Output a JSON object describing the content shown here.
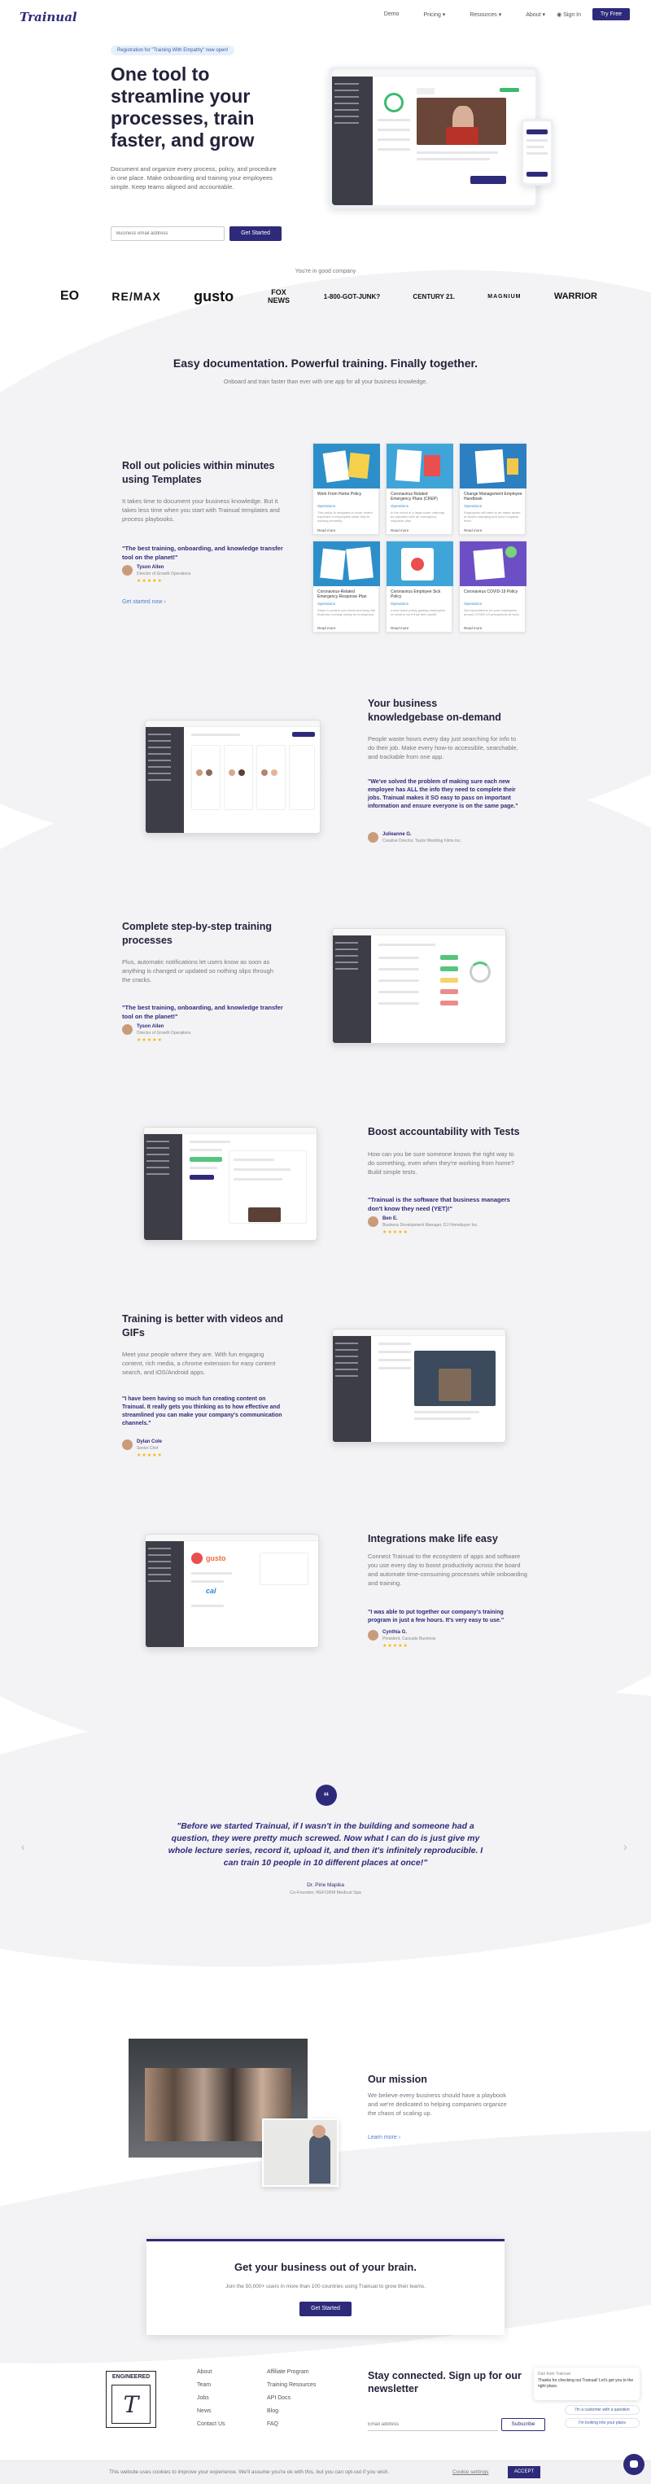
{
  "nav": {
    "logo": "Trainual",
    "links": [
      "Demo",
      "Pricing ▾",
      "Resources ▾",
      "About ▾"
    ],
    "sign_in": "Sign In",
    "try_free": "Try Free"
  },
  "hero": {
    "pill": "Registration for \"Training With Empathy\" now open!",
    "headline": "One tool to streamline your processes, train faster, and grow",
    "lead": "Document and organize every process, policy, and procedure in one place. Make onboarding and training your employees simple. Keep teams aligned and accountable.",
    "email_placeholder": "Business email address",
    "cta": "Get Started"
  },
  "company": {
    "label": "You're in good company",
    "logos": [
      "EO",
      "RE/MAX",
      "gusto",
      "FOX NEWS",
      "1-800-GOT-JUNK?",
      "CENTURY 21.",
      "MAGNIUM",
      "WARRIOR"
    ]
  },
  "intro": {
    "title": "Easy documentation. Powerful training. Finally together.",
    "subtitle": "Onboard and train faster than ever with one app for all your business knowledge."
  },
  "features": [
    {
      "title": "Roll out policies within minutes using Templates",
      "text": "It takes time to document your business knowledge. But it takes less time when you start with Trainual templates and process playbooks.",
      "quote": "\"The best training, onboarding, and knowledge transfer tool on the planet!\"",
      "author": "Tyson Allen",
      "role": "Director of Growth Operations",
      "link": "Get started now ›"
    },
    {
      "title": "Your business knowledgebase on-demand",
      "text": "People waste hours every day just searching for info to do their job. Make every how-to accessible, searchable, and trackable from one app.",
      "quote": "\"We've solved the problem of making sure each new employee has ALL the info they need to complete their jobs. Trainual makes it SO easy to pass on important information and ensure everyone is on the same page.\"",
      "author": "Julieanne G.",
      "role": "Creative Director, Taylor Wedding Films Inc."
    },
    {
      "title": "Complete step-by-step training processes",
      "text": "Plus, automatic notifications let users know as soon as anything is changed or updated so nothing slips through the cracks.",
      "quote": "\"The best training, onboarding, and knowledge transfer tool on the planet!\"",
      "author": "Tyson Allen",
      "role": "Director of Growth Operations"
    },
    {
      "title": "Boost accountability with Tests",
      "text": "How can you be sure someone knows the right way to do something, even when they're working from home? Build simple tests.",
      "quote": "\"Trainual is the software that business managers don't know they need (YET)!\"",
      "author": "Ben E.",
      "role": "Business Development Manager, DJ Homebuyer Inc."
    },
    {
      "title": "Training is better with videos and GIFs",
      "text": "Meet your people where they are. With fun engaging content, rich media, a chrome extension for easy content search, and iOS/Android apps.",
      "quote": "\"I have been having so much fun creating content on Trainual. It really gets you thinking as to how effective and streamlined you can make your company's communication channels.\"",
      "author": "Dylan Cole",
      "role": "Senior Chef"
    },
    {
      "title": "Integrations make life easy",
      "text": "Connect Trainual to the ecosystem of apps and software you use every day to boost productivity across the board and automate time-consuming processes while onboarding and training.",
      "quote": "\"I was able to put together our company's training program in just a few hours. It's very easy to use.\"",
      "author": "Cynthia G.",
      "role": "President, Cascade Business"
    }
  ],
  "stars": "★★★★★",
  "templates": [
    {
      "title": "Work From Home Policy",
      "tag": "Operations",
      "desc": "This policy is designed to cover what's expected of employees while they're working remotely.",
      "more": "Read more"
    },
    {
      "title": "Coronavirus Related Emergency Plans (CREP)",
      "tag": "Operations",
      "desc": "In the event of a large-scale outbreak, be prepared with an emergency response plan.",
      "more": "Read more"
    },
    {
      "title": "Change Management Employee Handbook",
      "tag": "Operations",
      "desc": "Employees will need to be made aware of what's changing and how it impacts them.",
      "more": "Read more"
    },
    {
      "title": "Coronavirus-Related Emergency Response Plan",
      "tag": "Operations",
      "desc": "Steps to protect your team and keep the business running during an emergency.",
      "more": "Read more"
    },
    {
      "title": "Coronavirus Employee Sick Policy",
      "tag": "Operations",
      "desc": "A sick leave policy guiding employees on what to do if they feel unwell.",
      "more": "Read more"
    },
    {
      "title": "Coronavirus COVID-19 Policy",
      "tag": "Operations",
      "desc": "Set expectations for your employees around COVID-19 precautions at work.",
      "more": "Read more"
    }
  ],
  "testimonial": {
    "quote": "\"Before we started Trainual, if I wasn't in the building and someone had a question, they were pretty much screwed. Now what I can do is just give my whole lecture series, record it, upload it, and then it's infinitely reproducible. I can train 10 people in 10 different places at once!\"",
    "author": "Dr. Pirie Mapika",
    "role": "Co-Founder, REFORM Medical Spa"
  },
  "mission": {
    "title": "Our mission",
    "text": "We believe every business should have a playbook and we're dedicated to helping companies organize the chaos of scaling up.",
    "link": "Learn more ›"
  },
  "cta": {
    "title": "Get your business out of your brain.",
    "text": "Join the 50,000+ users in more than 100 countries using Trainual to grow their teams.",
    "button": "Get Started"
  },
  "footer": {
    "badge": "ENGINEERED",
    "col1": [
      "About",
      "Team",
      "Jobs",
      "News",
      "Contact Us"
    ],
    "col2": [
      "Affiliate Program",
      "Training Resources",
      "API Docs",
      "Blog",
      "FAQ"
    ],
    "newsletter_title": "Stay connected. Sign up for our newsletter",
    "email_placeholder": "Email address",
    "subscribe": "Subscribe"
  },
  "chat": {
    "name": "Dan from Trainual",
    "msg": "Thanks for checking out Trainual! Let's get you to the right place.",
    "opt1": "I'm a customer with a question",
    "opt2": "I'm looking into your plans"
  },
  "cookie": {
    "text": "This website uses cookies to improve your experience. We'll assume you're ok with this, but you can opt-out if you wish.",
    "settings": "Cookie settings",
    "accept": "ACCEPT"
  }
}
